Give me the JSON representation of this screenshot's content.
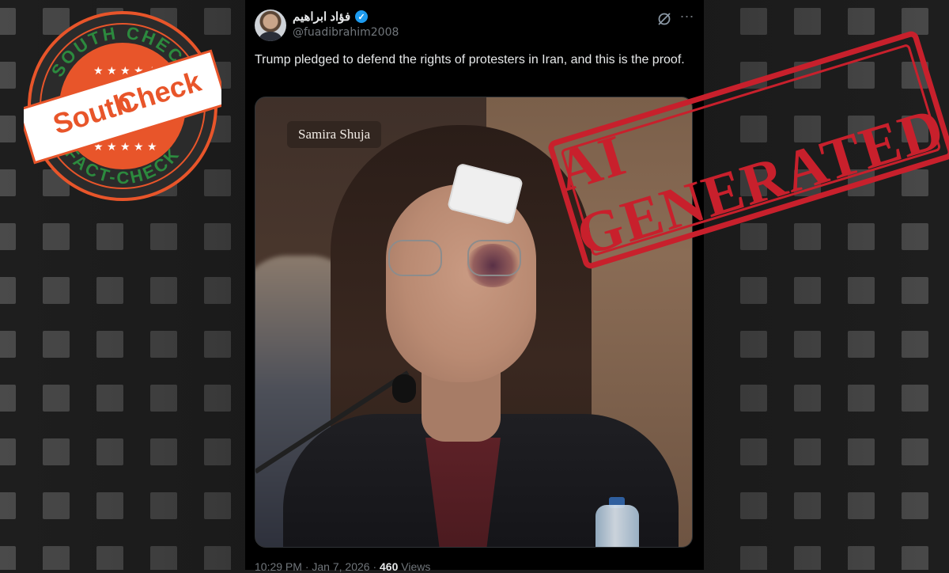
{
  "background": {
    "tile_color": "#4a4a4a",
    "base_color": "#1c1c1c"
  },
  "logo": {
    "top_text": "SOUTH CHECK",
    "bottom_text": "FACT-CHECK",
    "word1": "South",
    "word2": "Check",
    "ring_color": "#2b2b2b",
    "accent_color": "#e8552a",
    "brand_green": "#2c8a3e"
  },
  "tweet": {
    "display_name": "فؤاد ابراهيم",
    "handle": "@fuadibrahim2008",
    "verified": true,
    "text": "Trump pledged to defend the rights of protesters in Iran, and this is the proof.",
    "image_caption": "Samira Shuja",
    "time": "10:29 PM",
    "date": "Jan 7, 2026",
    "views_count": "460",
    "views_label": "Views",
    "icons": {
      "grok": "grok-icon",
      "more": "more-icon",
      "verified": "verified-badge-icon"
    }
  },
  "stamp": {
    "text": "AI GENERATED",
    "color": "#c8202c"
  }
}
